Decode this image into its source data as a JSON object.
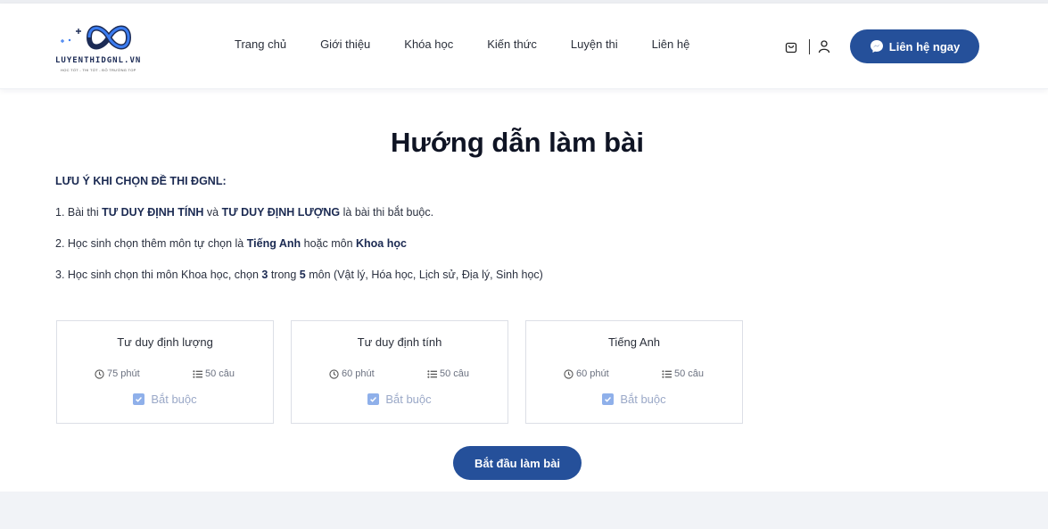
{
  "brand": {
    "name": "LUYENTHIDGNL.VN",
    "tagline": "HỌC TỐT - THI TỐT - ĐỖ TRƯỜNG TOP",
    "colors": {
      "primary": "#25509a",
      "logo_dark": "#1c2b55",
      "logo_blue": "#3b7cf0",
      "checkbox": "#8fb0ea"
    }
  },
  "nav": {
    "items": [
      {
        "label": "Trang chủ"
      },
      {
        "label": "Giới thiệu"
      },
      {
        "label": "Khóa học"
      },
      {
        "label": "Kiến thức"
      },
      {
        "label": "Luyện thi"
      },
      {
        "label": "Liên hệ"
      }
    ]
  },
  "header": {
    "icons": [
      "cart-icon",
      "user-icon",
      "messenger-icon"
    ],
    "contact_label": "Liên hệ ngay"
  },
  "page": {
    "title": "Hướng dẫn làm bài",
    "note_title": "LƯU Ý KHI CHỌN ĐỀ THI ĐGNL:",
    "line1": {
      "a": "1. Bài thi ",
      "b1": "TƯ DUY ĐỊNH TÍNH",
      "c": " và ",
      "b2": "TƯ DUY ĐỊNH LƯỢNG",
      "d": " là bài thi bắt buộc."
    },
    "line2": {
      "a": "2. Học sinh chọn thêm môn tự chọn là ",
      "b1": "Tiếng Anh",
      "c": " hoặc môn ",
      "b2": "Khoa học"
    },
    "line3": {
      "a": "3. Học sinh chọn thi môn Khoa học, chọn ",
      "b1": "3",
      "c": " trong ",
      "b2": "5",
      "d": " môn (Vật lý, Hóa học, Lịch sử, Địa lý, Sinh học)"
    }
  },
  "cards": [
    {
      "name": "Tư duy định lượng",
      "time": "75 phút",
      "questions": "50 câu",
      "required": "Bắt buộc"
    },
    {
      "name": "Tư duy định tính",
      "time": "60 phút",
      "questions": "50 câu",
      "required": "Bắt buộc"
    },
    {
      "name": "Tiếng Anh",
      "time": "60 phút",
      "questions": "50 câu",
      "required": "Bắt buộc"
    }
  ],
  "start_label": "Bắt đầu làm bài"
}
